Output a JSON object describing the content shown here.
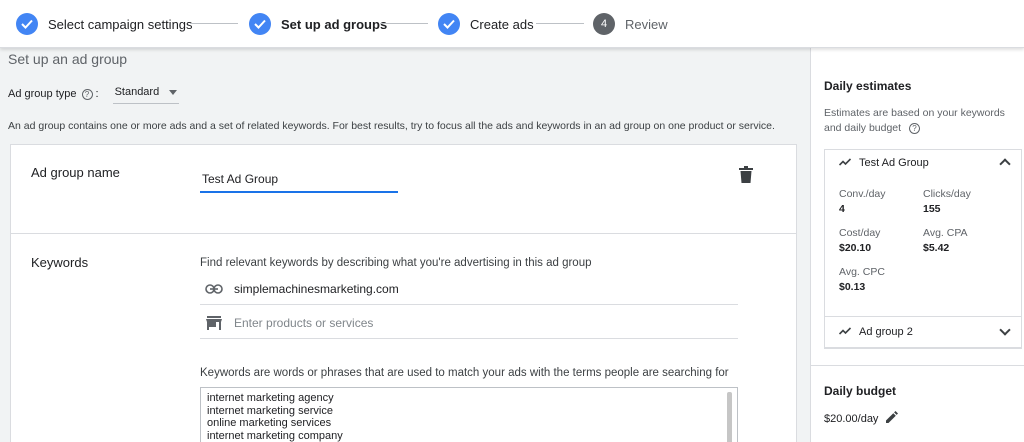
{
  "stepper": {
    "steps": [
      {
        "label": "Select campaign settings",
        "state": "done"
      },
      {
        "label": "Set up ad groups",
        "state": "current"
      },
      {
        "label": "Create ads",
        "state": "done"
      },
      {
        "label": "Review",
        "state": "pending",
        "number": "4"
      }
    ]
  },
  "main": {
    "section_title": "Set up an ad group",
    "ad_group_type_label": "Ad group type",
    "ad_group_type_value": "Standard",
    "description": "An ad group contains one or more ads and a set of related keywords. For best results, try to focus all the ads and keywords in an ad group on one product or service.",
    "ad_group_name_label": "Ad group name",
    "ad_group_name_value": "Test Ad Group",
    "keywords_label": "Keywords",
    "keywords_hint": "Find relevant keywords by describing what you're advertising in this ad group",
    "website_value": "simplemachinesmarketing.com",
    "products_placeholder": "Enter products or services",
    "keywords_note": "Keywords are words or phrases that are used to match your ads with the terms people are searching for",
    "keywords": [
      "internet marketing agency",
      "internet marketing service",
      "online marketing services",
      "internet marketing company"
    ]
  },
  "panel": {
    "title": "Daily estimates",
    "subtitle": "Estimates are based on your keywords and daily budget",
    "group1": {
      "name": "Test Ad Group",
      "conv_label": "Conv./day",
      "conv_value": "4",
      "clicks_label": "Clicks/day",
      "clicks_value": "155",
      "cost_label": "Cost/day",
      "cost_value": "$20.10",
      "cpa_label": "Avg. CPA",
      "cpa_value": "$5.42",
      "cpc_label": "Avg. CPC",
      "cpc_value": "$0.13"
    },
    "group2": {
      "name": "Ad group 2"
    },
    "budget_title": "Daily budget",
    "budget_value": "$20.00/day"
  },
  "colors": {
    "accent": "#1a73e8",
    "step_done": "#4285f4"
  }
}
